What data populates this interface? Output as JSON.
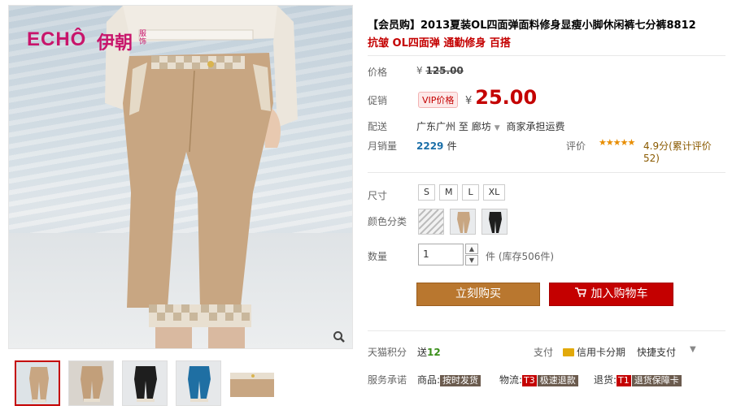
{
  "gallery": {
    "brand": "ECHÔ",
    "brand_cn": "伊朝",
    "brand_small": "服饰",
    "zoom_icon": "magnifier-icon",
    "thumbnails": [
      "khaki-front",
      "khaki-side",
      "black-front",
      "blue-front",
      "detail-waist"
    ]
  },
  "product": {
    "title": "【会员购】2013夏装OL四面弹面料修身显瘦小脚休闲裤七分裤8812",
    "subtitle": "抗皱 OL四面弹 通勤修身 百搭"
  },
  "price": {
    "label": "价格",
    "currency": "¥",
    "original": "125.00",
    "promo_label": "促销",
    "vip_badge": "VIP价格",
    "promo": "25.00"
  },
  "shipping": {
    "label": "配送",
    "from": "广东广州",
    "to_word": "至",
    "dest": "廊坊",
    "fee": "商家承担运费"
  },
  "sales": {
    "label": "月销量",
    "count": "2229",
    "unit": "件",
    "rating_label": "评价",
    "stars": "★★★★★",
    "rating_text": "4.9分(累计评价52)"
  },
  "options": {
    "size_label": "尺寸",
    "sizes": [
      "S",
      "M",
      "L",
      "XL"
    ],
    "color_label": "颜色分类",
    "qty_label": "数量",
    "qty_value": "1",
    "stock_unit": "件",
    "stock": "(库存506件)"
  },
  "actions": {
    "buy_now": "立刻购买",
    "add_cart": "加入购物车"
  },
  "footer": {
    "points_label": "天猫积分",
    "points_prefix": "送",
    "points": "12",
    "pay_label": "支付",
    "credit": "信用卡分期",
    "quickpay": "快捷支付",
    "service_label": "服务承诺",
    "svc1_prefix": "商品:",
    "svc1": "按时发货",
    "svc2_prefix": "物流:",
    "svc2_t1": "T3",
    "svc2": "极速退款",
    "svc3_prefix": "退货:",
    "svc3_t1": "T1",
    "svc3": "退货保障卡"
  },
  "colors": {
    "accent": "#c40000",
    "buy": "#b9772f",
    "brand": "#c8156b"
  }
}
